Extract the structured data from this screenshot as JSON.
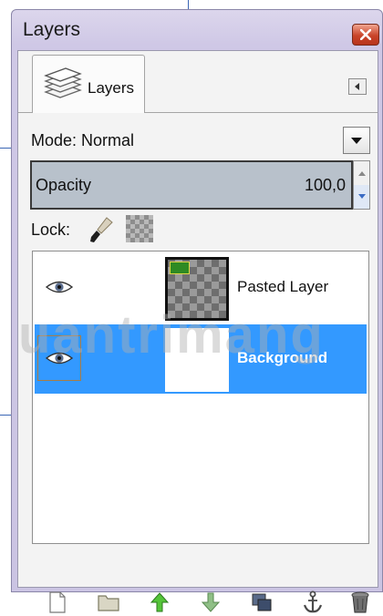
{
  "window": {
    "title": "Layers"
  },
  "tab": {
    "label": "Layers",
    "icon": "layers-stack-icon"
  },
  "mode": {
    "label": "Mode:",
    "value": "Normal"
  },
  "opacity": {
    "label": "Opacity",
    "value": "100,0"
  },
  "lock": {
    "label": "Lock:",
    "icons": [
      "paintbrush-icon",
      "alpha-checker-icon"
    ]
  },
  "layers": [
    {
      "name": "Pasted Layer",
      "visible": true,
      "selected": false
    },
    {
      "name": "Background",
      "visible": true,
      "selected": true
    }
  ],
  "watermark": "uantrimang",
  "toolbar": {
    "icons": [
      "new-layer-icon",
      "open-folder-icon",
      "raise-layer-icon",
      "lower-layer-icon",
      "duplicate-layer-icon",
      "anchor-layer-icon",
      "delete-layer-icon"
    ]
  },
  "colors": {
    "selection": "#3399ff",
    "opacity_bar": "#b8c1cb"
  }
}
